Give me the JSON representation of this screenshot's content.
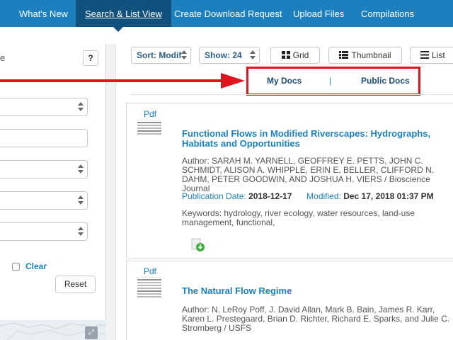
{
  "nav": {
    "items": [
      "What's New",
      "Search & List View",
      "Create Download Request",
      "Upload Files",
      "Compilations"
    ],
    "active_index": 1
  },
  "filters": {
    "help_label": "?",
    "edge_char": "e",
    "clear_label": "Clear",
    "reset_label": "Reset"
  },
  "toolbar": {
    "sort_label": "Sort: Modif",
    "show_label": "Show: 24",
    "grid_label": "Grid",
    "thumbnail_label": "Thumbnail",
    "list_label": "List"
  },
  "scope": {
    "my_docs": "My Docs",
    "separator": "|",
    "public_docs": "Public Docs"
  },
  "results": [
    {
      "type": "Pdf",
      "title": "Functional Flows in Modified Riverscapes: Hydrographs, Habitats and Opportunities",
      "author": "Author: SARAH M. YARNELL, GEOFFREY E. PETTS, JOHN C. SCHMIDT, ALISON A. WHIPPLE, ERIN E. BELLER, CLIFFORD N. DAHM, PETER GOODWIN, AND JOSHUA H. VIERS / Bioscience Journal",
      "pub_label": "Publication Date:",
      "pub_date": "2018-12-17",
      "mod_label": "Modified:",
      "mod_date": "Dec 17, 2018 01:37 PM",
      "keywords": "Keywords: hydrology, river ecology, water resources, land-use management, functional,"
    },
    {
      "type": "Pdf",
      "title": "The Natural Flow Regime",
      "author": "Author: N. LeRoy Poff, J. David Allan, Mark B. Bain, James R. Karr, Karen L. Prestegaard, Brian D. Richter, Richard E. Sparks, and Julie C. Stromberg / USFS"
    }
  ],
  "colors": {
    "nav_bg": "#1c80bf",
    "nav_active": "#11517d",
    "link": "#1c80bf",
    "annotation": "#e1141e"
  },
  "icons": {
    "grid": "grid-icon",
    "thumbnail": "thumbnail-icon",
    "list": "list-icon",
    "download": "download-icon",
    "expand": "expand-icon"
  }
}
